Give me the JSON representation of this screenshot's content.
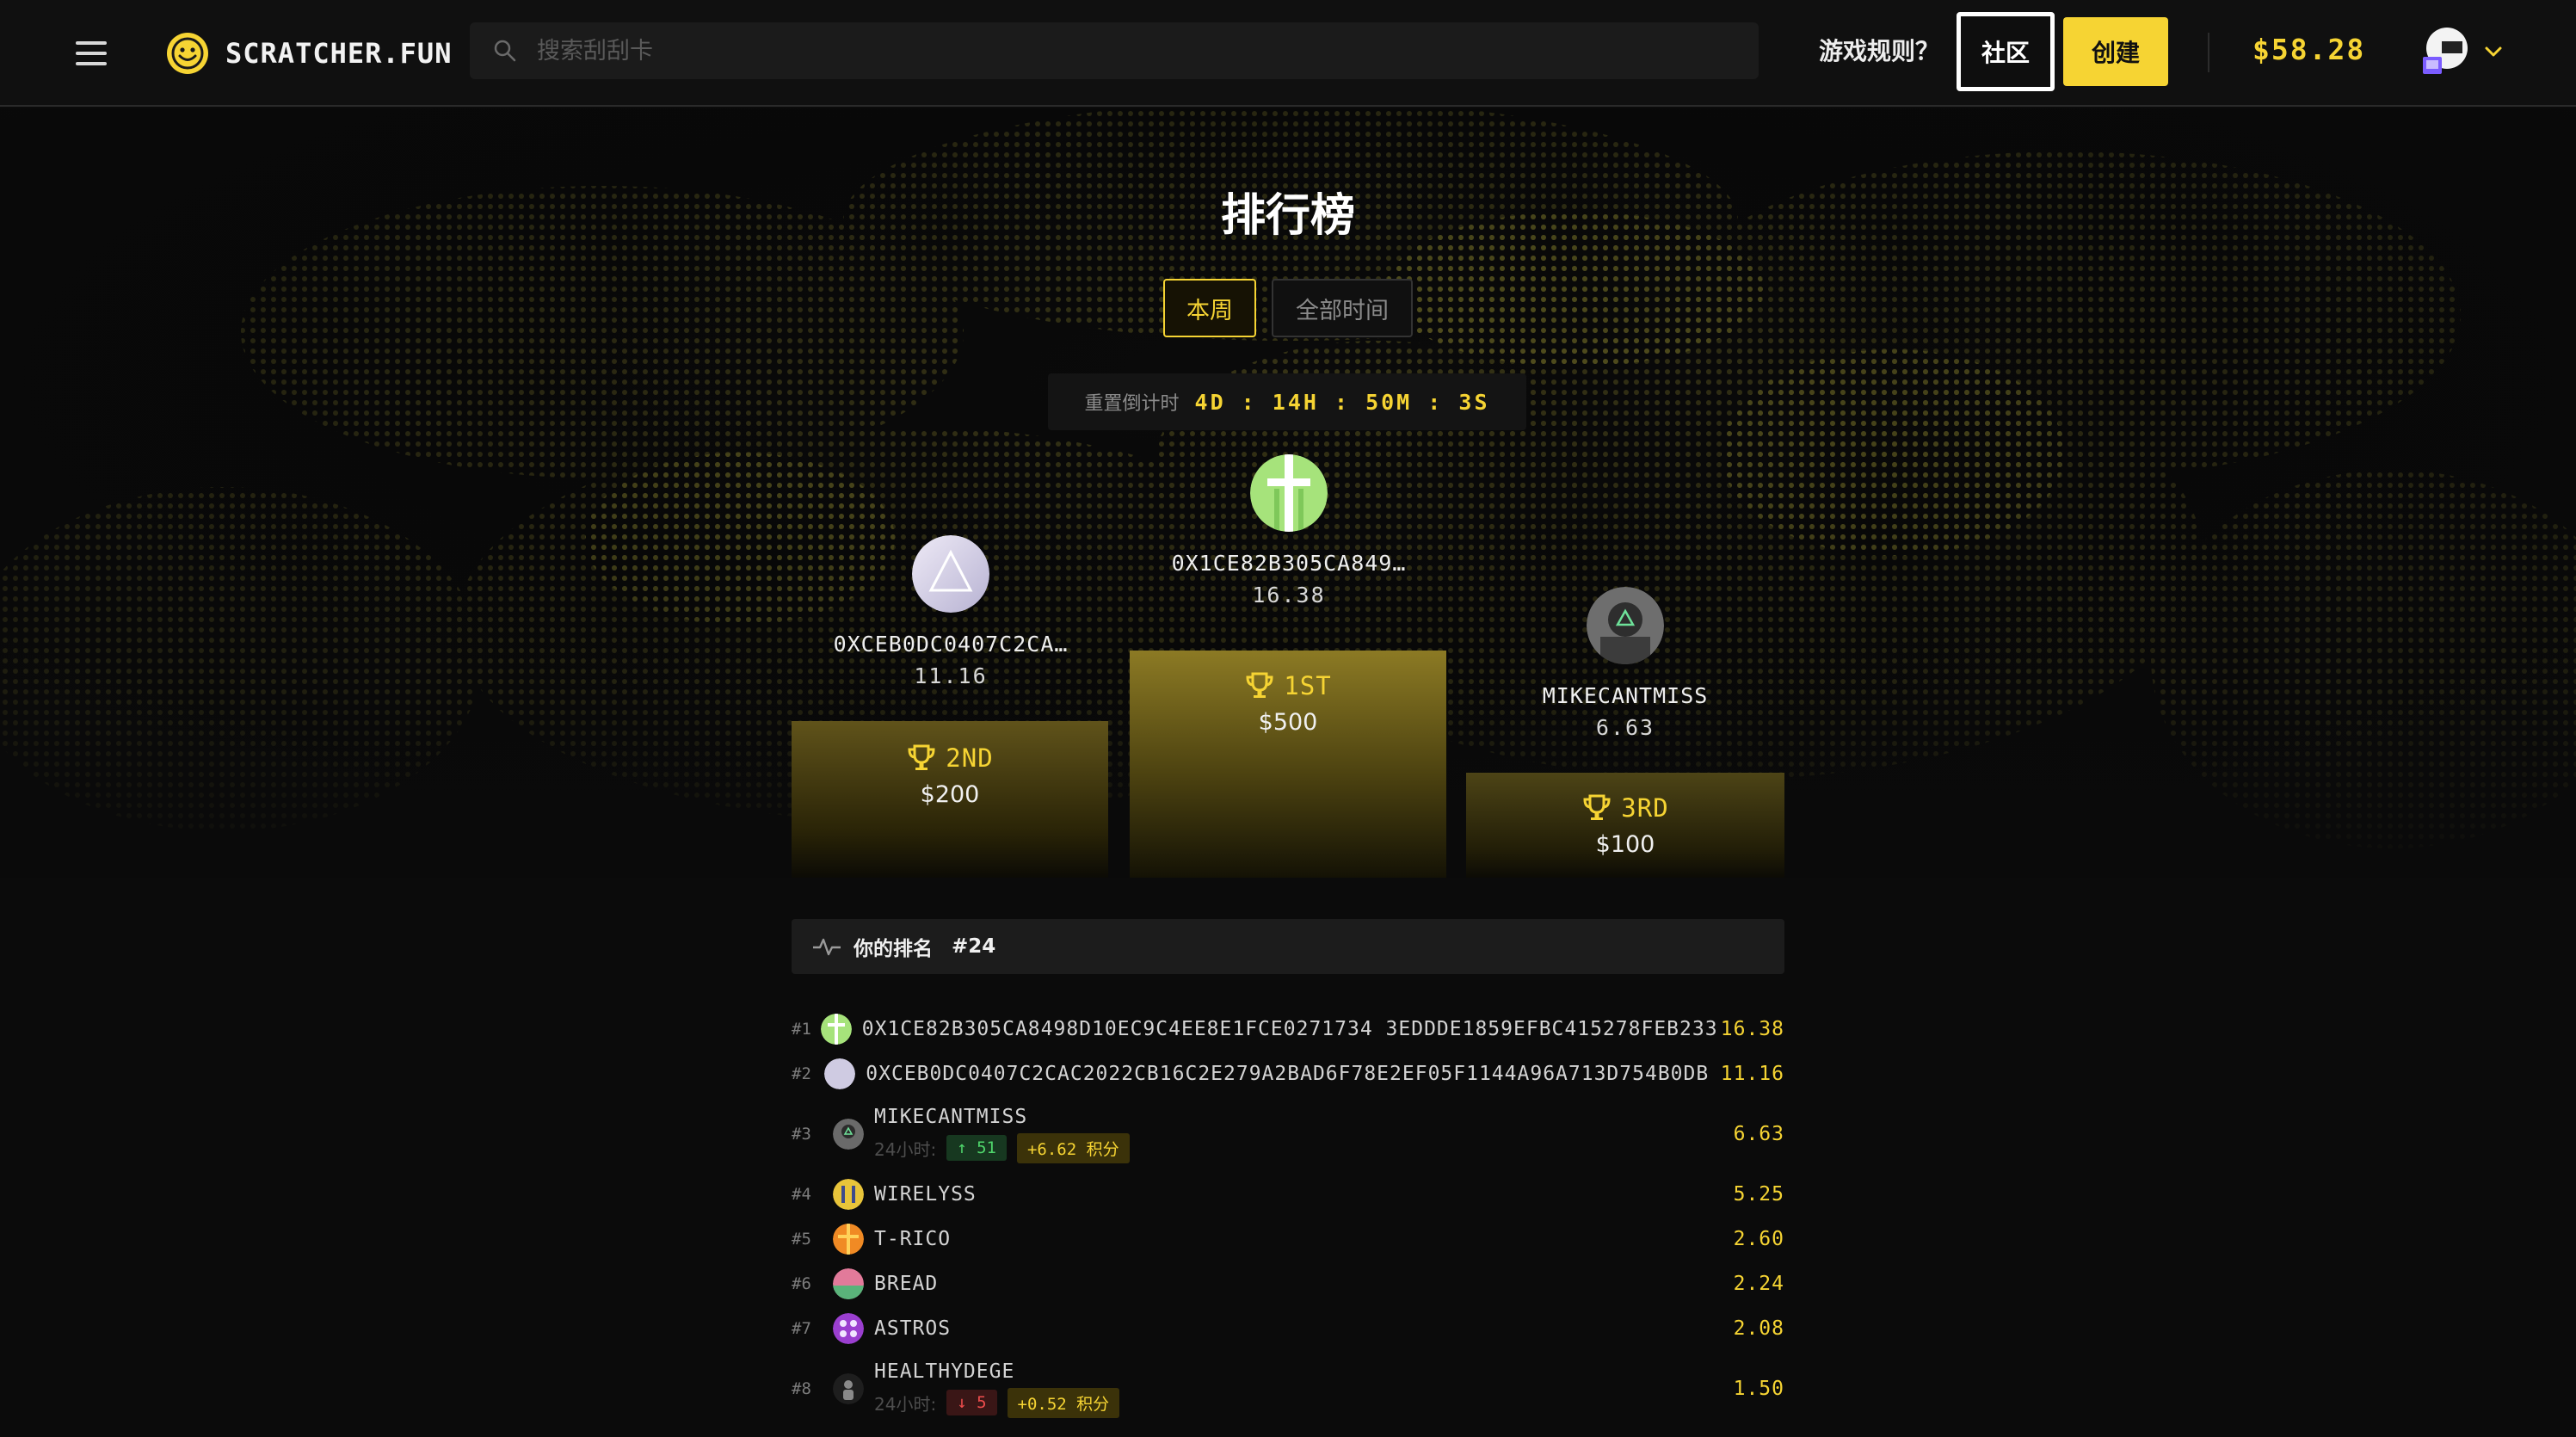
{
  "header": {
    "logo_text": "SCRATCHER.FUN",
    "search_placeholder": "搜索刮刮卡",
    "rules_label": "游戏规则？",
    "community_label": "社区",
    "create_label": "创建",
    "balance": "$58.28",
    "accent_color": "#f6d433"
  },
  "page": {
    "title": "排行榜",
    "tabs": [
      {
        "label": "本周",
        "active": true
      },
      {
        "label": "全部时间",
        "active": false
      }
    ],
    "countdown_label": "重置倒计时",
    "countdown_value": "4D : 14H : 50M : 3S"
  },
  "podium": {
    "first": {
      "name": "0X1CE82B305CA849…",
      "score": "16.38",
      "rank": "1ST",
      "prize": "$500"
    },
    "second": {
      "name": "0XCEB0DC0407C2CA…",
      "score": "11.16",
      "rank": "2ND",
      "prize": "$200"
    },
    "third": {
      "name": "MIKECANTMISS",
      "score": "6.63",
      "rank": "3RD",
      "prize": "$100"
    }
  },
  "my_rank": {
    "label": "你的排名",
    "value": "#24"
  },
  "leaderboard": [
    {
      "rank": "#1",
      "name": "0X1CE82B305CA8498D10EC9C4EE8E1FCE0271734 3EDDDE1859EFBC415278FEB233",
      "score": "16.38",
      "avatar": "green-gift"
    },
    {
      "rank": "#2",
      "name": "0XCEB0DC0407C2CAC2022CB16C2E279A2BAD6F78E2EF05F1144A96A713D754B0DB",
      "score": "11.16",
      "avatar": "lavender-triangle"
    },
    {
      "rank": "#3",
      "name": "MIKECANTMISS",
      "score": "6.63",
      "avatar": "gray-portrait",
      "sub_label": "24小时:",
      "change": "↑ 51",
      "change_dir": "up",
      "points": "+6.62 积分"
    },
    {
      "rank": "#4",
      "name": "WIRELYSS",
      "score": "5.25",
      "avatar": "yellow-blue"
    },
    {
      "rank": "#5",
      "name": "T-RICO",
      "score": "2.60",
      "avatar": "orange-gift"
    },
    {
      "rank": "#6",
      "name": "BREAD",
      "score": "2.24",
      "avatar": "pink-green"
    },
    {
      "rank": "#7",
      "name": "ASTROS",
      "score": "2.08",
      "avatar": "purple-pattern"
    },
    {
      "rank": "#8",
      "name": "HEALTHYDEGE",
      "score": "1.50",
      "avatar": "dark-figure",
      "sub_label": "24小时:",
      "change": "↓ 5",
      "change_dir": "down",
      "points": "+0.52 积分"
    }
  ]
}
